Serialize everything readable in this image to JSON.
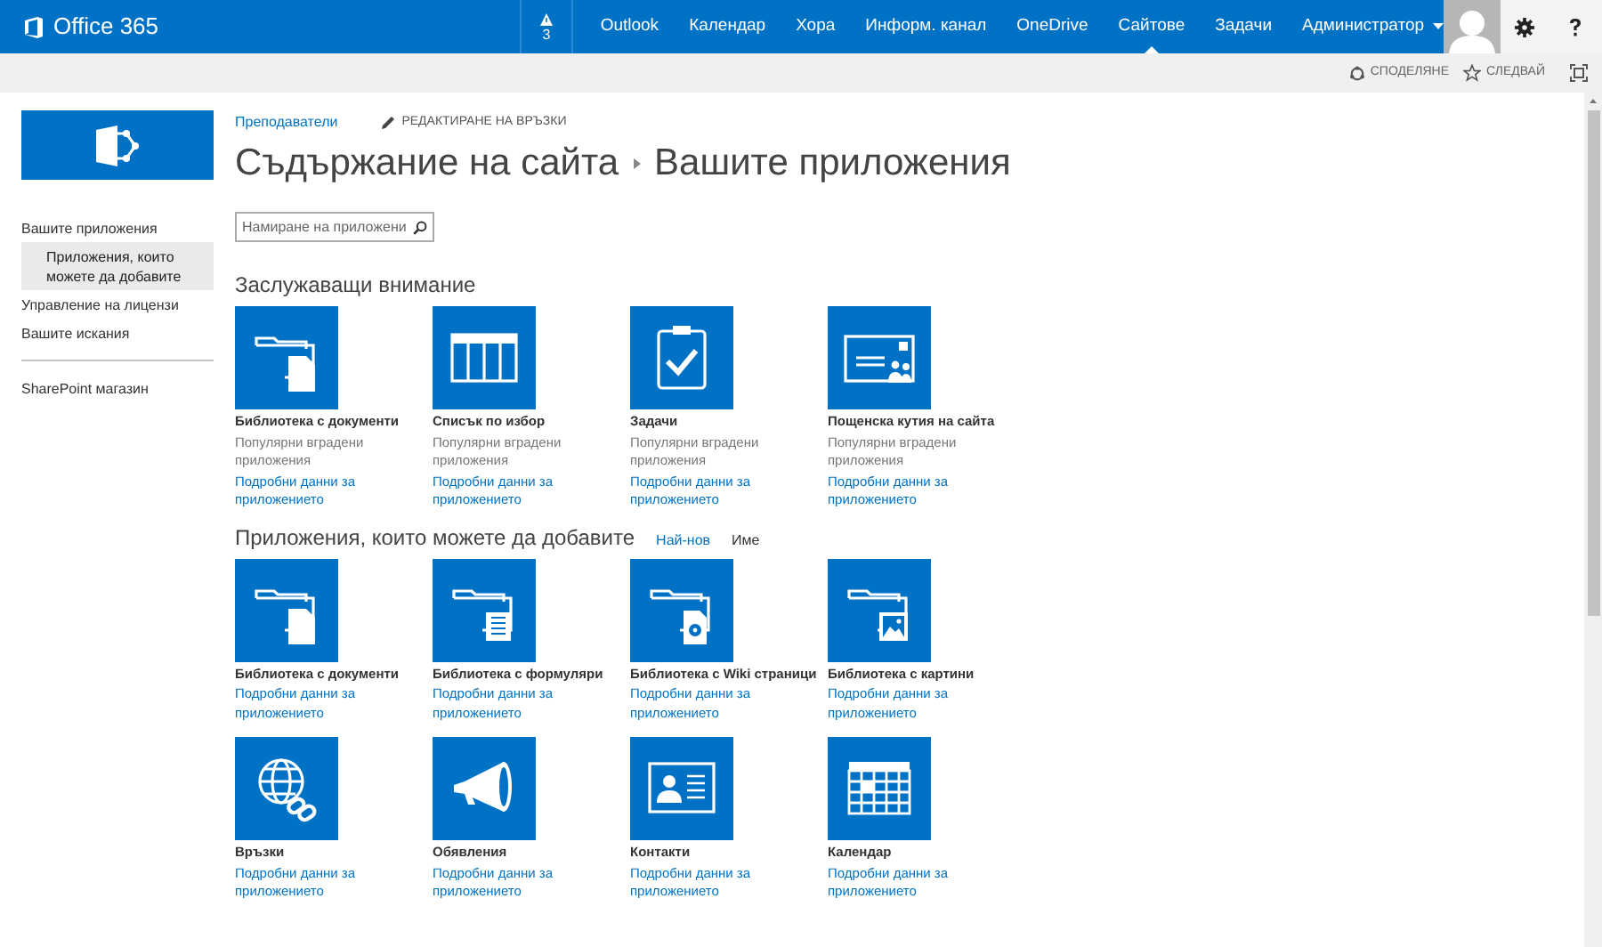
{
  "suite_bar": {
    "brand": "Office 365",
    "notifications": "3",
    "nav": [
      {
        "label": "Outlook",
        "selected": false
      },
      {
        "label": "Календар",
        "selected": false
      },
      {
        "label": "Хора",
        "selected": false
      },
      {
        "label": "Информ. канал",
        "selected": false
      },
      {
        "label": "OneDrive",
        "selected": false
      },
      {
        "label": "Сайтове",
        "selected": true
      },
      {
        "label": "Задачи",
        "selected": false
      },
      {
        "label": "Администратор",
        "selected": false,
        "menu": true
      }
    ]
  },
  "command_bar": {
    "share": "СПОДЕЛЯНЕ",
    "follow": "СЛЕДВАЙ"
  },
  "left_nav": [
    {
      "label": "Вашите приложения",
      "selected": false,
      "children": [
        {
          "label": "Приложения, които можете да добавите",
          "selected": true
        }
      ]
    },
    {
      "label": "Управление на лицензи",
      "selected": false
    },
    {
      "label": "Вашите искания",
      "selected": false
    },
    {
      "label": "SharePoint магазин",
      "selected": false,
      "separated": true
    }
  ],
  "breadcrumb": {
    "site": "Преподаватели",
    "edit_links": "РЕДАКТИРАНЕ НА ВРЪЗКИ",
    "title": "Съдържание на сайта",
    "subtitle": "Вашите приложения"
  },
  "search": {
    "placeholder": "Намиране на приложени"
  },
  "sections": [
    {
      "heading": "Заслужаващи внимание",
      "apps": [
        {
          "kind": "document-library",
          "name": "Библиотека с документи",
          "description": "Популярни вградени приложения",
          "link": "Подробни данни за приложението"
        },
        {
          "kind": "custom-list",
          "name": "Списък по избор",
          "description": "Популярни вградени приложения",
          "link": "Подробни данни за приложението"
        },
        {
          "kind": "tasks",
          "name": "Задачи",
          "description": "Популярни вградени приложения",
          "link": "Подробни данни за приложението"
        },
        {
          "kind": "site-mailbox",
          "name": "Пощенска кутия на сайта",
          "description": "Популярни вградени приложения",
          "link": "Подробни данни за приложението"
        }
      ]
    },
    {
      "heading": "Приложения, които можете да добавите",
      "sort_options": [
        {
          "label": "Най-нов",
          "selected": false
        },
        {
          "label": "Име",
          "selected": true
        }
      ],
      "apps": [
        {
          "kind": "document-library",
          "name": "Библиотека с документи",
          "link": "Подробни данни за приложението"
        },
        {
          "kind": "form-library",
          "name": "Библиотека с формуляри",
          "link": "Подробни данни за приложението"
        },
        {
          "kind": "wiki-library",
          "name": "Библиотека с Wiki страници",
          "link": "Подробни данни за приложението"
        },
        {
          "kind": "picture-library",
          "name": "Библиотека с картини",
          "link": "Подробни данни за приложението"
        },
        {
          "kind": "links",
          "name": "Връзки",
          "link": "Подробни данни за приложението"
        },
        {
          "kind": "announcements",
          "name": "Обявления",
          "link": "Подробни данни за приложението"
        },
        {
          "kind": "contacts",
          "name": "Контакти",
          "link": "Подробни данни за приложението"
        },
        {
          "kind": "calendar",
          "name": "Календар",
          "link": "Подробни данни за приложението"
        }
      ]
    }
  ]
}
